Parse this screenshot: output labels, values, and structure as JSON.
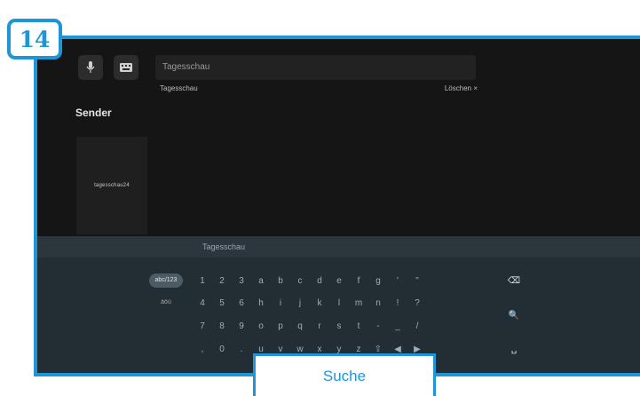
{
  "step_badge": "14",
  "search": {
    "query": "Tagesschau",
    "suggestion": "Tagesschau",
    "clear_label": "Löschen ×"
  },
  "section_title": "Sender",
  "channel": {
    "logo_text": "tagesschau24"
  },
  "keyboard": {
    "input_text": "Tagesschau",
    "mode_keys": [
      "abc/123",
      "äöü"
    ],
    "rows": [
      [
        "1",
        "2",
        "3",
        "a",
        "b",
        "c",
        "d",
        "e",
        "f",
        "g",
        "'",
        "\""
      ],
      [
        "4",
        "5",
        "6",
        "h",
        "i",
        "j",
        "k",
        "l",
        "m",
        "n",
        "!",
        "?"
      ],
      [
        "7",
        "8",
        "9",
        "o",
        "p",
        "q",
        "r",
        "s",
        "t",
        "-",
        "_",
        "/"
      ],
      [
        ",",
        "0",
        ".",
        "u",
        "v",
        "w",
        "x",
        "y",
        "z",
        "⇧",
        "◀",
        "▶"
      ]
    ],
    "action_keys": {
      "backspace": "⌫",
      "search": "🔍",
      "space": "␣"
    }
  },
  "callout_label": "Suche",
  "colors": {
    "accent": "#1e96d6",
    "screen_bg": "#151515",
    "keyboard_bg": "#232d34"
  }
}
